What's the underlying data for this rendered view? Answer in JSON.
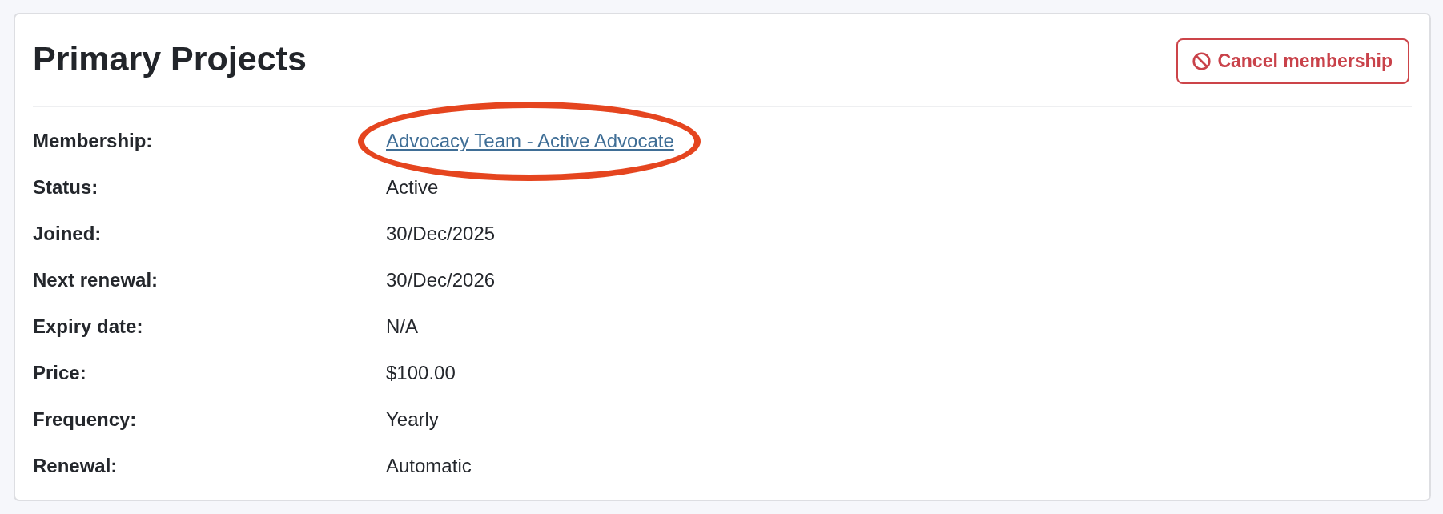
{
  "card": {
    "title": "Primary Projects",
    "action": {
      "label": "Cancel membership"
    }
  },
  "rows": [
    {
      "label": "Membership:",
      "value": "Advocacy Team - Active Advocate",
      "kind": "link",
      "highlighted": true
    },
    {
      "label": "Status:",
      "value": "Active",
      "kind": "text",
      "highlighted": false
    },
    {
      "label": "Joined:",
      "value": "30/Dec/2025",
      "kind": "text",
      "highlighted": false
    },
    {
      "label": "Next renewal:",
      "value": "30/Dec/2026",
      "kind": "text",
      "highlighted": false
    },
    {
      "label": "Expiry date:",
      "value": "N/A",
      "kind": "text",
      "highlighted": false
    },
    {
      "label": "Price:",
      "value": "$100.00",
      "kind": "text",
      "highlighted": false
    },
    {
      "label": "Frequency:",
      "value": "Yearly",
      "kind": "text",
      "highlighted": false
    },
    {
      "label": "Renewal:",
      "value": "Automatic",
      "kind": "text",
      "highlighted": false
    }
  ]
}
